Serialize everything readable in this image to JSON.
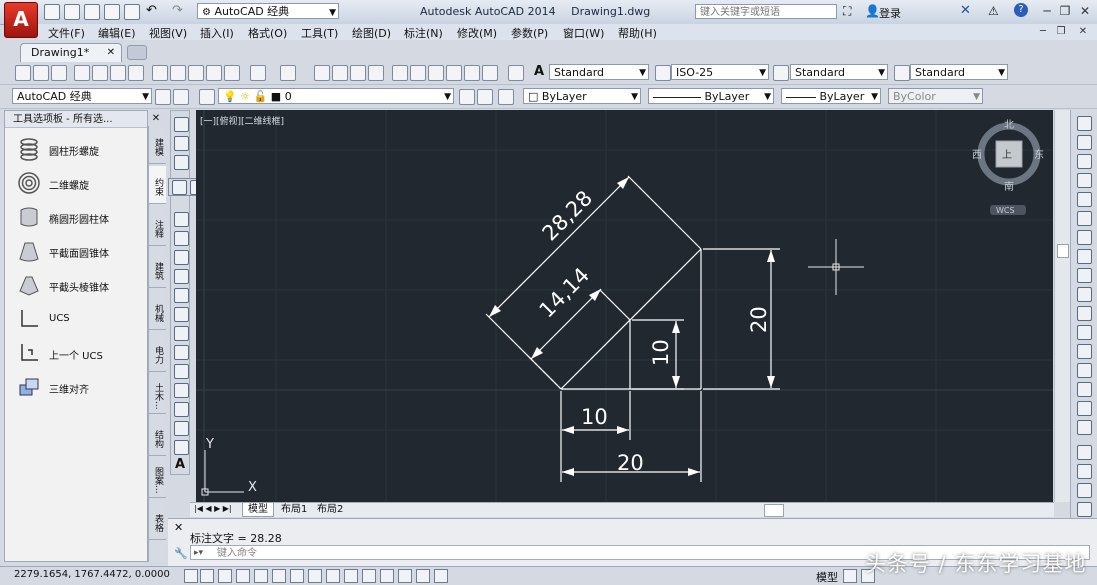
{
  "app": {
    "logo_letter": "A",
    "title": "Autodesk AutoCAD 2014",
    "document": "Drawing1.dwg",
    "workspace": "AutoCAD 经典",
    "search_placeholder": "键入关键字或短语",
    "login_label": "登录"
  },
  "menu": [
    "文件(F)",
    "编辑(E)",
    "视图(V)",
    "插入(I)",
    "格式(O)",
    "工具(T)",
    "绘图(D)",
    "标注(N)",
    "修改(M)",
    "参数(P)",
    "窗口(W)",
    "帮助(H)"
  ],
  "tabs": {
    "document_tab": "Drawing1*"
  },
  "styles_toolbar": {
    "text_style": "Standard",
    "dim_style": "ISO-25",
    "table_style": "Standard",
    "multileader_style": "Standard"
  },
  "layers_toolbar": {
    "workspace": "AutoCAD 经典",
    "layer": "0",
    "color": "ByLayer",
    "linetype": "ByLayer",
    "lineweight": "ByLayer",
    "plotstyle": "ByColor"
  },
  "palette": {
    "title": "工具选项板 - 所有选...",
    "items": [
      {
        "label": "圆柱形螺旋",
        "icon": "helix-icon"
      },
      {
        "label": "二维螺旋",
        "icon": "spiral-icon"
      },
      {
        "label": "椭圆形圆柱体",
        "icon": "elliptical-cylinder-icon"
      },
      {
        "label": "平截面圆锥体",
        "icon": "frustum-cone-icon"
      },
      {
        "label": "平截头棱锥体",
        "icon": "frustum-pyramid-icon"
      },
      {
        "label": "UCS",
        "icon": "ucs-icon"
      },
      {
        "label": "上一个 UCS",
        "icon": "previous-ucs-icon"
      },
      {
        "label": "三维对齐",
        "icon": "3d-align-icon"
      }
    ],
    "side_tabs": [
      "建模",
      "约束",
      "注释",
      "建筑",
      "机械",
      "电力",
      "土木...",
      "结构",
      "图案...",
      "表格"
    ]
  },
  "viewport": {
    "label": "[一][俯视][二维线框]",
    "viewcube": {
      "north": "北",
      "south": "南",
      "east": "东",
      "west": "西",
      "top": "上",
      "wcs": "WCS"
    },
    "ucs": {
      "x": "X",
      "y": "Y"
    }
  },
  "drawing": {
    "dims": [
      "28,28",
      "14,14",
      "20",
      "10",
      "10",
      "20"
    ]
  },
  "layout_tabs": [
    "模型",
    "布局1",
    "布局2"
  ],
  "command": {
    "history": "标注文字 = 28.28",
    "input_placeholder": "键入命令"
  },
  "status": {
    "coords": "2279.1654, 1767.4472, 0.0000",
    "model_label": "模型"
  },
  "watermark": "头条号 / 东东学习基地"
}
